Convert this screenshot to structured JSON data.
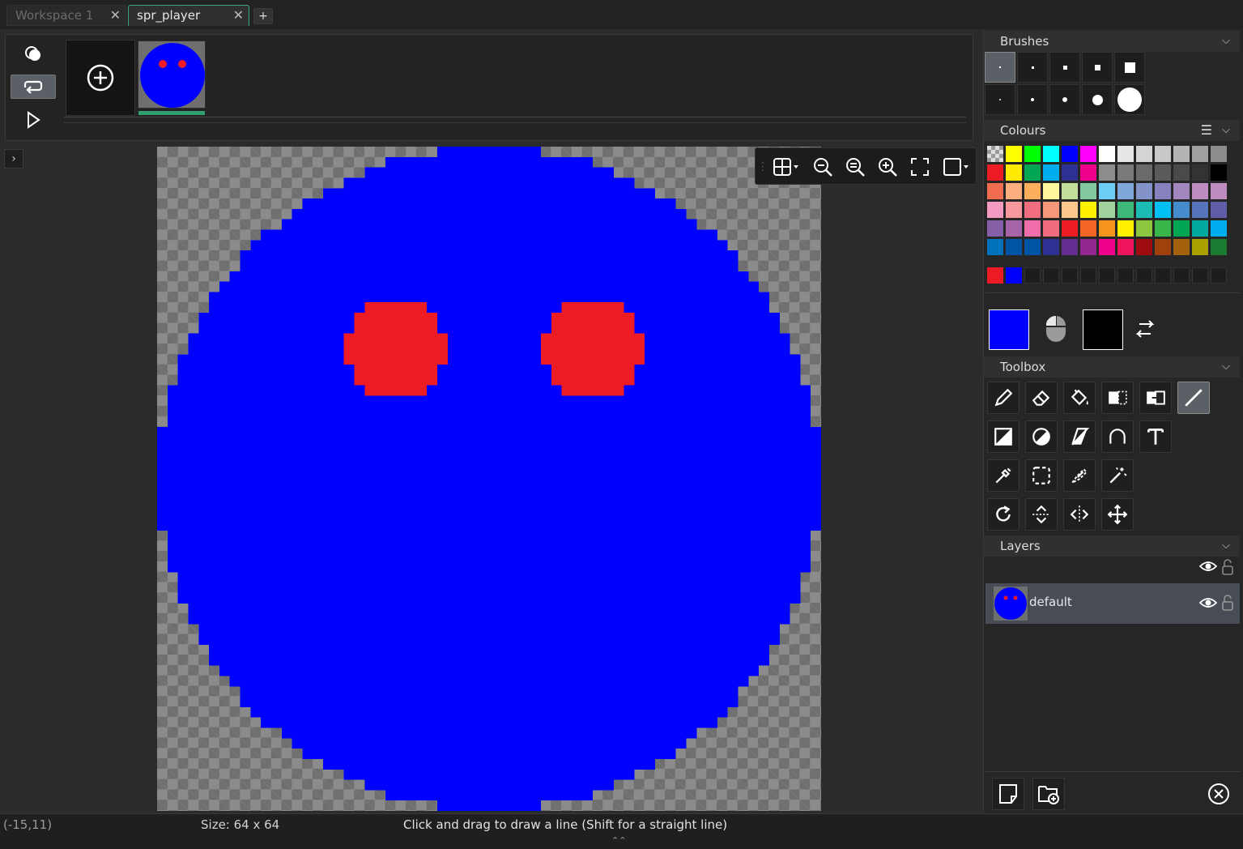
{
  "tabs": [
    {
      "label": "Workspace 1",
      "active": false
    },
    {
      "label": "spr_player",
      "active": true
    }
  ],
  "add_tab_label": "+",
  "frames": {
    "count": 1
  },
  "canvas": {
    "width": 64,
    "height": 64,
    "fill_color": "#0000ff",
    "eye_color": "#ed1c24"
  },
  "panels": {
    "brushes": {
      "title": "Brushes"
    },
    "colours": {
      "title": "Colours",
      "palette": [
        [
          "transparent",
          "#ffff00",
          "#00ff00",
          "#00ffff",
          "#0000ff",
          "#ff00ff",
          "#ffffff",
          "#e6e6e6",
          "#d4d4d4",
          "#c8c8c8",
          "#b4b4b4",
          "#a0a0a0",
          "#8c8c8c"
        ],
        [
          "#ed1c24",
          "#ffea00",
          "#00a651",
          "#00aeef",
          "#2e3192",
          "#ec008c",
          "#8c8c8c",
          "#7a7a7a",
          "#6a6a6a",
          "#5a5a5a",
          "#4a4a4a",
          "#333333",
          "#000000"
        ],
        [
          "#f26c4f",
          "#f9ad81",
          "#fbaf5d",
          "#fff799",
          "#c4df9b",
          "#82ca9d",
          "#6dcff6",
          "#7da7d9",
          "#8393ca",
          "#8781bd",
          "#a187be",
          "#bd8cbf",
          "#bd8cbf"
        ],
        [
          "#f49ac1",
          "#f6989d",
          "#f26d7d",
          "#f7977a",
          "#fdc68a",
          "#fff200",
          "#a3d39c",
          "#3cb878",
          "#1cbbb4",
          "#00bff3",
          "#448ccb",
          "#5674b9",
          "#605ca8"
        ],
        [
          "#855fa8",
          "#a864a8",
          "#f06ea9",
          "#f26c7d",
          "#ed1c24",
          "#f26522",
          "#f7941d",
          "#fff200",
          "#8dc63f",
          "#39b54a",
          "#00a651",
          "#00a99d",
          "#00aeef"
        ],
        [
          "#0072bc",
          "#0054a6",
          "#0054a6",
          "#2e3192",
          "#662d91",
          "#92278f",
          "#ec008c",
          "#ed145b",
          "#9e0b0f",
          "#a0410d",
          "#a36209",
          "#aba000",
          "#1a7b30"
        ]
      ],
      "recent": [
        "#ed1c24",
        "#0000ff"
      ],
      "primary_color": "#0000ff",
      "secondary_color": "#000000"
    },
    "toolbox": {
      "title": "Toolbox",
      "tools": [
        "pencil",
        "eraser",
        "fill",
        "select-paste",
        "paste-replace",
        "line",
        "rectangle",
        "ellipse",
        "polygon",
        "arc",
        "text",
        "eyedropper",
        "rect-select",
        "lasso-select",
        "magic-wand",
        "rotate",
        "flip-vertical",
        "flip-horizontal",
        "move"
      ],
      "selected": "line"
    },
    "layers": {
      "title": "Layers",
      "items": [
        {
          "name": "default",
          "visible": true,
          "locked": false
        }
      ]
    }
  },
  "status": {
    "coords": "(-15,11)",
    "size": "Size: 64 x 64",
    "hint": "Click and drag to draw a line (Shift for a straight line)"
  }
}
